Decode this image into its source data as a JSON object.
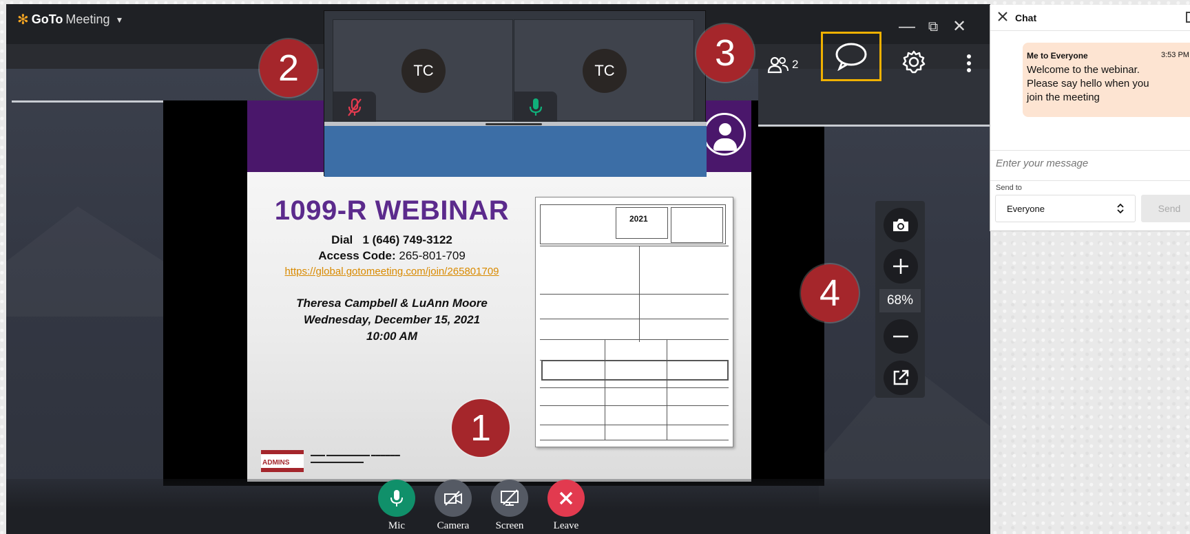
{
  "app": {
    "name_part1": "GoTo",
    "name_part2": "Meeting"
  },
  "window_controls": {
    "minimize": "—",
    "restore": "⧉",
    "close": "✕"
  },
  "toolbar": {
    "participants_count": "2"
  },
  "videos": [
    {
      "initials": "TC",
      "mic": "muted"
    },
    {
      "initials": "TC",
      "mic": "on"
    }
  ],
  "slide": {
    "title": "1099-R WEBINAR",
    "dial_label": "Dial",
    "dial_number": "1 (646) 749-3122",
    "access_label": "Access Code:",
    "access_code": "265-801-709",
    "link": "https://global.gotomeeting.com/join/265801709",
    "presenters": "Theresa Campbell & LuAnn Moore",
    "date": "Wednesday, December 15, 2021",
    "time": "10:00 AM",
    "form_year": "2021",
    "logo_text": "ADMINS"
  },
  "zoom": {
    "level": "68%"
  },
  "controls": {
    "mic_label": "Mic",
    "camera_label": "Camera",
    "screen_label": "Screen",
    "leave_label": "Leave"
  },
  "callouts": {
    "c1": "1",
    "c2": "2",
    "c3": "3",
    "c4": "4"
  },
  "chat": {
    "title": "Chat",
    "message": {
      "sender": "Me to Everyone",
      "time": "3:53 PM",
      "body": "Welcome to the webinar. Please say hello when you join the meeting"
    },
    "input_placeholder": "Enter your message",
    "send_to_label": "Send to",
    "send_to_value": "Everyone",
    "send_label": "Send"
  },
  "colors": {
    "accent_highlight": "#f0b100",
    "callout_red": "#a5262b",
    "mic_green": "#10906a",
    "leave_red": "#e23a4f",
    "slide_purple": "#5b2a8c"
  }
}
